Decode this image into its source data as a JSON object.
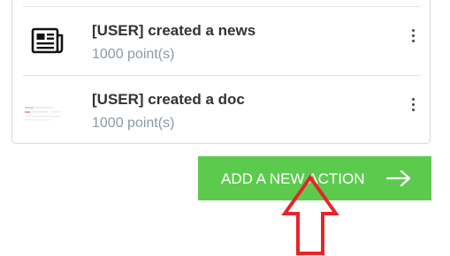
{
  "actions": [
    {
      "title": "[USER] created a news",
      "points": "1000 point(s)",
      "icon": "newspaper-icon"
    },
    {
      "title": "[USER] created a doc",
      "points": "1000 point(s)",
      "icon": "document-thumbnail-icon"
    }
  ],
  "add_button": {
    "label": "ADD A NEW ACTION",
    "icon": "arrow-right-icon"
  },
  "annotation": {
    "icon": "red-up-arrow-icon"
  },
  "colors": {
    "button_bg": "#5ccb4d",
    "button_text": "#ffffff",
    "title_text": "#333333",
    "points_text": "#8f98a3",
    "annotation": "#e8242a"
  }
}
